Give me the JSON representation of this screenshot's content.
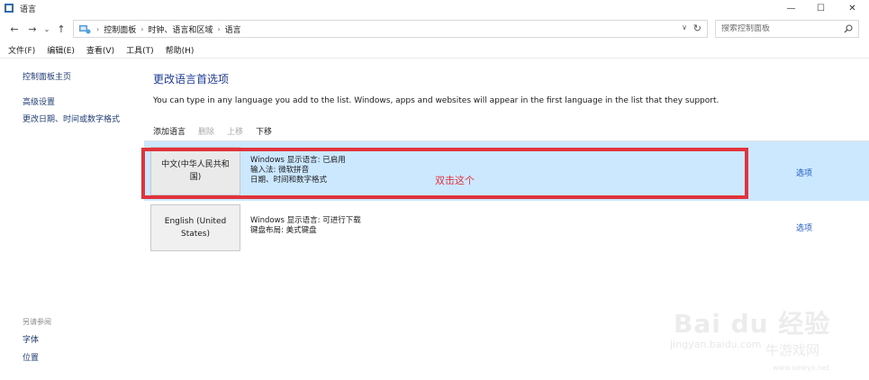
{
  "window": {
    "title": "语言",
    "minimize_icon": "minimize-icon",
    "maximize_icon": "maximize-icon",
    "close_icon": "close-icon"
  },
  "address_bar": {
    "breadcrumbs": [
      "控制面板",
      "时钟、语言和区域",
      "语言"
    ],
    "search_placeholder": "搜索控制面板"
  },
  "menu": {
    "items": [
      "文件(F)",
      "编辑(E)",
      "查看(V)",
      "工具(T)",
      "帮助(H)"
    ]
  },
  "sidebar": {
    "home": "控制面板主页",
    "links": [
      "高级设置",
      "更改日期、时间或数字格式"
    ],
    "see_also_heading": "另请参阅",
    "see_also": [
      "字体",
      "位置"
    ]
  },
  "main": {
    "title": "更改语言首选项",
    "description": "You can type in any language you add to the list. Windows, apps and websites will appear in the first language in the list that they support.",
    "toolbar": {
      "add": "添加语言",
      "remove": "删除",
      "move_up": "上移",
      "move_down": "下移"
    },
    "languages": [
      {
        "name": "中文(中华人民共和国)",
        "details": [
          "Windows 显示语言: 已启用",
          "输入法: 微软拼音",
          "日期、时间和数字格式"
        ],
        "options": "选项",
        "selected": true
      },
      {
        "name": "English (United States)",
        "details": [
          "Windows 显示语言: 可进行下载",
          "键盘布局: 美式键盘"
        ],
        "options": "选项",
        "selected": false
      }
    ]
  },
  "annotation": {
    "text": "双击这个",
    "color": "#e0333c"
  },
  "watermark": {
    "brand": "Bai du 经验",
    "url_partial": "jingyan.baidu.com",
    "site": "牛游戏网",
    "site_url": "www.newyx.net"
  },
  "colors": {
    "selected_row": "#cce8ff",
    "link": "#1e57c9",
    "title": "#1e3c9a"
  }
}
